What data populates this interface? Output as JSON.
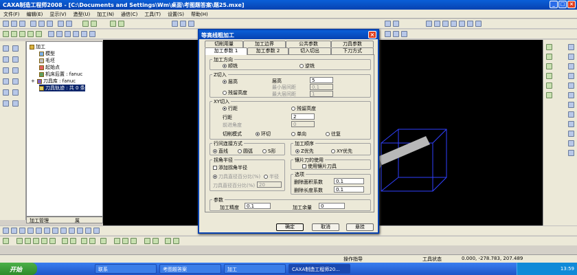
{
  "app": {
    "title": "CAXA制造工程师2008 - [C:\\Documents and Settings\\Wm\\桌面\\考图题答案\\题25.mxe]"
  },
  "menu": [
    "文件(F)",
    "编辑(E)",
    "显示(V)",
    "造型(U)",
    "加工(N)",
    "通信(C)",
    "工具(T)",
    "设置(S)",
    "帮助(H)"
  ],
  "tree": {
    "root": "加工",
    "items": [
      "模型",
      "毛坯",
      "起始点",
      "机床后置 : fanuc",
      "刀具库 : fanuc",
      "刀具轨迹 : 共 0 条"
    ],
    "tabs": [
      "加工管理",
      "属"
    ]
  },
  "dialog": {
    "title": "等高线粗加工",
    "tabs_row1": [
      "切削用量",
      "加工边界",
      "公共参数",
      "刀具参数"
    ],
    "tabs_row2": [
      "加工参数 1",
      "加工参数 2",
      "切入切出",
      "下刀方式"
    ],
    "direction": {
      "label": "加工方向",
      "opt1": "顺铣",
      "opt2": "逆铣"
    },
    "z": {
      "label": "Z切入",
      "layer_height": "层高",
      "residual": "残留高度",
      "h_label": "层高",
      "h_val": "5",
      "min_label": "最小层间距",
      "min_val": "0.1",
      "max_label": "最大层间距",
      "max_val": "1"
    },
    "xy": {
      "label": "XY切入",
      "row_spacing": "行距",
      "residual": "残留高度",
      "rs_label": "行距",
      "rs_val": "2",
      "angle_label": "前进角度",
      "angle_val": "0",
      "mode_label": "切削模式",
      "mode1": "环切",
      "mode2": "单向",
      "mode3": "往复"
    },
    "link": {
      "label": "行间连接方式",
      "o1": "直线",
      "o2": "圆弧",
      "o3": "S形"
    },
    "order": {
      "label": "加工顺序",
      "o1": "Z优先",
      "o2": "XY优先"
    },
    "insert": {
      "label": "镶片刀的使用",
      "chk": "使用镶片刀具"
    },
    "corner": {
      "label": "拐角半径",
      "chk": "添加拐角半径",
      "r1": "刀具直径百分比(%)",
      "r2": "半径",
      "pct_label": "刀具直径百分比(%)",
      "pct_val": "20"
    },
    "options": {
      "label": "选项",
      "area_label": "删除面积系数",
      "area_val": "0.1",
      "len_label": "删除长度系数",
      "len_val": "0.1"
    },
    "params": {
      "label": "参数",
      "prec_label": "加工精度",
      "prec_val": "0.1",
      "allow_label": "加工余量",
      "allow_val": "0"
    },
    "buttons": {
      "ok": "确定",
      "cancel": "取消",
      "hang": "悬挂"
    }
  },
  "status": {
    "hint": "操作指导",
    "tool": "工具状态",
    "coords": "0.000, -278.783, 207.489"
  },
  "taskbar": {
    "start": "开始",
    "tasks": [
      "联系",
      "考图题答案",
      "加工",
      "CAXA制造工程师20..."
    ],
    "clock": "13:59"
  }
}
